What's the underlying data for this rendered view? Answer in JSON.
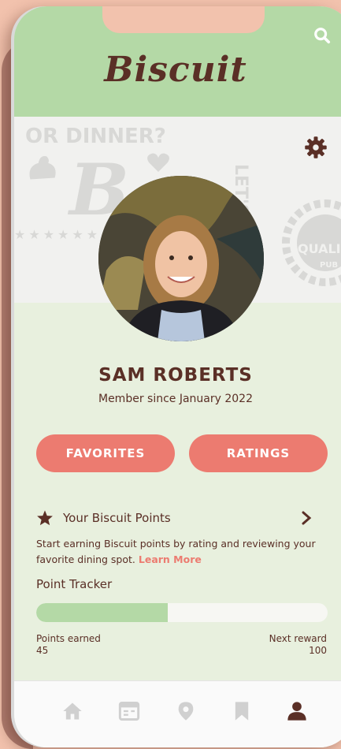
{
  "app": {
    "logo": "Biscuit"
  },
  "banner": {
    "line1": "OR DINNER?",
    "side": "LET'S EAT",
    "quality": "QUALI",
    "pub": "PUB"
  },
  "profile": {
    "name": "SAM ROBERTS",
    "member_since": "Member since January 2022"
  },
  "buttons": {
    "favorites": "FAVORITES",
    "ratings": "RATINGS"
  },
  "points": {
    "title": "Your Biscuit Points",
    "description": "Start earning Biscuit points by rating and reviewing your favorite dining spot.",
    "learn_more": "Learn More"
  },
  "tracker": {
    "title": "Point Tracker",
    "earned_label": "Points earned",
    "earned_value": 45,
    "next_label": "Next reward",
    "next_value": 100,
    "progress_fraction": 0.45
  },
  "icons": {
    "search": "search-icon",
    "gear": "gear-icon",
    "star": "star-icon",
    "chevron": "chevron-right-icon",
    "home": "home-icon",
    "menu": "menu-icon",
    "location": "location-pin-icon",
    "bookmark": "bookmark-icon",
    "profile": "user-icon"
  },
  "colors": {
    "header": "#b4d9a6",
    "brand_text": "#5a2f26",
    "accent": "#ec7b70",
    "body_bg": "#e8f0de",
    "tab_inactive": "#d0d0d0"
  }
}
